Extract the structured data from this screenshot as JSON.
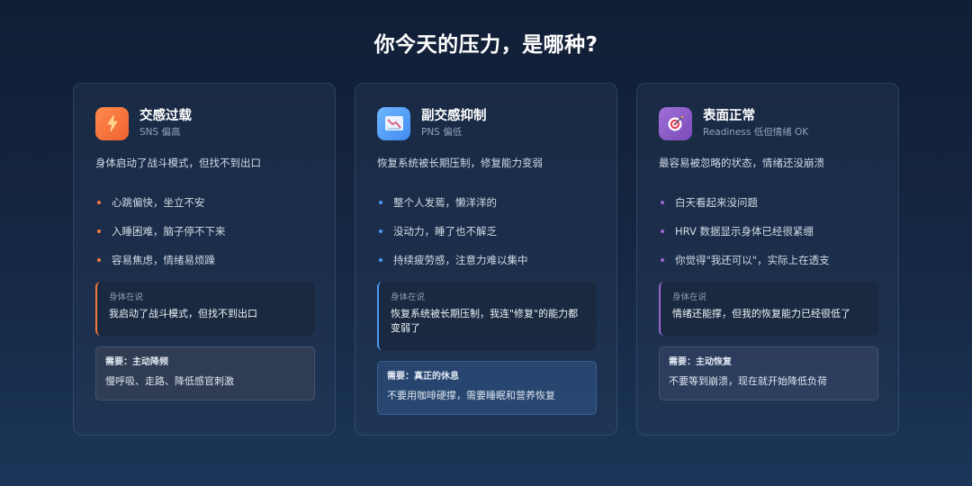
{
  "page": {
    "title": "你今天的压力，是哪种?"
  },
  "cards": [
    {
      "icon": "lightning-icon",
      "accent": "#f5793f",
      "title": "交感过载",
      "subtitle": "SNS 偏高",
      "description": "身体启动了战斗模式，但找不到出口",
      "symptoms": [
        "心跳偏快，坐立不安",
        "入睡困难，脑子停不下来",
        "容易焦虑，情绪易烦躁"
      ],
      "quote_label": "身体在说",
      "quote": "我启动了战斗模式，但找不到出口",
      "need_label": "需要：主动降频",
      "need": "慢呼吸、走路、降低感官刺激"
    },
    {
      "icon": "chart-down-icon",
      "accent": "#4f98f5",
      "title": "副交感抑制",
      "subtitle": "PNS 偏低",
      "description": "恢复系统被长期压制，修复能力变弱",
      "symptoms": [
        "整个人发蔫，懒洋洋的",
        "没动力，睡了也不解乏",
        "持续疲劳感，注意力难以集中"
      ],
      "quote_label": "身体在说",
      "quote": "恢复系统被长期压制，我连\"修复\"的能力都变弱了",
      "need_label": "需要：真正的休息",
      "need": "不要用咖啡硬撑，需要睡眠和营养恢复"
    },
    {
      "icon": "target-icon",
      "accent": "#9a66d2",
      "title": "表面正常",
      "subtitle": "Readiness 低但情绪 OK",
      "description": "最容易被忽略的状态，情绪还没崩溃",
      "symptoms": [
        "白天看起来没问题",
        "HRV 数据显示身体已经很紧绷",
        "你觉得\"我还可以\"，实际上在透支"
      ],
      "quote_label": "身体在说",
      "quote": "情绪还能撑，但我的恢复能力已经很低了",
      "need_label": "需要：主动恢复",
      "need": "不要等到崩溃，现在就开始降低负荷"
    }
  ]
}
